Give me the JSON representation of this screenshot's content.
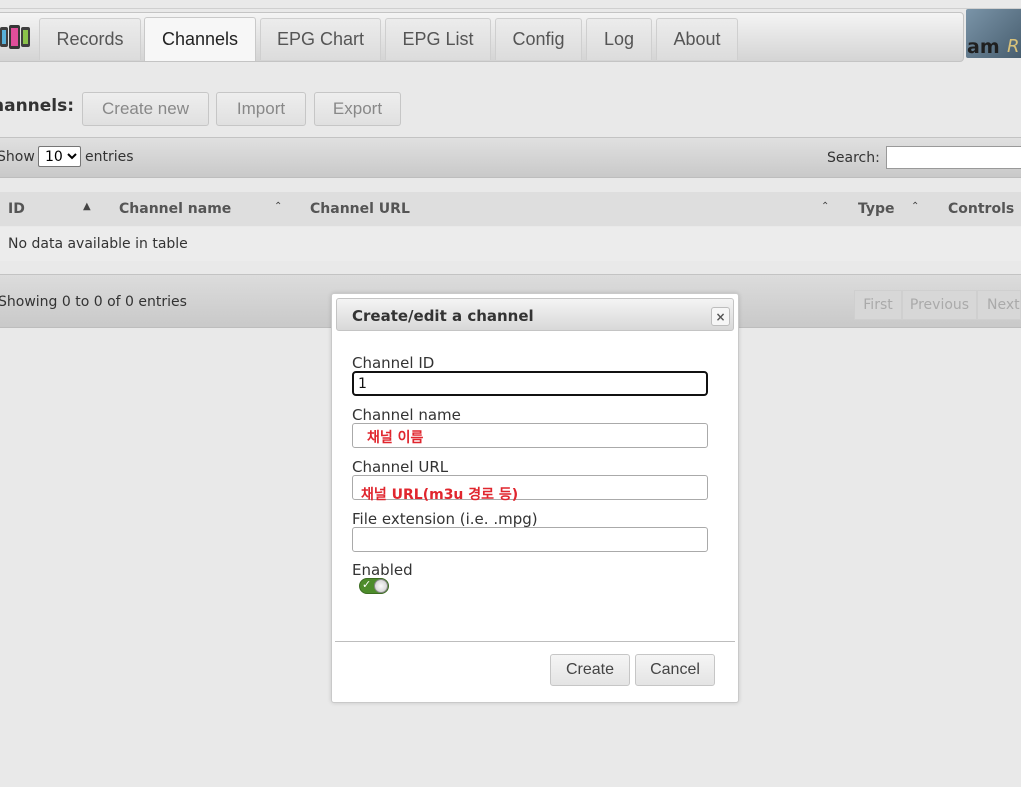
{
  "tabs": [
    {
      "label": "Records",
      "active": false
    },
    {
      "label": "Channels",
      "active": true
    },
    {
      "label": "EPG Chart",
      "active": false
    },
    {
      "label": "EPG List",
      "active": false
    },
    {
      "label": "Config",
      "active": false
    },
    {
      "label": "Log",
      "active": false
    },
    {
      "label": "About",
      "active": false
    }
  ],
  "brand": {
    "part1": "am",
    "part2": "R"
  },
  "toolbar": {
    "title": "hannels:",
    "create_label": "Create new",
    "import_label": "Import",
    "export_label": "Export"
  },
  "table_controls": {
    "show_label": "Show",
    "entries_value": "10",
    "entries_label": "entries",
    "search_label": "Search:"
  },
  "table": {
    "columns": [
      "ID",
      "Channel name",
      "Channel URL",
      "Type",
      "Controls"
    ],
    "empty_text": "No data available in table",
    "info_text": "Showing 0 to 0 of 0 entries",
    "pagination": {
      "first": "First",
      "previous": "Previous",
      "next": "Next"
    }
  },
  "dialog": {
    "title": "Create/edit a channel",
    "close_symbol": "×",
    "fields": {
      "id_label": "Channel ID",
      "id_value": "1",
      "name_label": "Channel name",
      "url_label": "Channel URL",
      "ext_label": "File extension (i.e. .mpg)",
      "enabled_label": "Enabled"
    },
    "annotations": {
      "name": "채널 이름",
      "url": "채널 URL(m3u 경로 등)"
    },
    "create_label": "Create",
    "cancel_label": "Cancel"
  },
  "colors": {
    "annotation": "#e0262e",
    "toggle_on": "#4d8c2b"
  },
  "icons": [
    "app-logo-icon",
    "close-icon",
    "check-icon",
    "sort-asc-icon",
    "sort-icon"
  ]
}
